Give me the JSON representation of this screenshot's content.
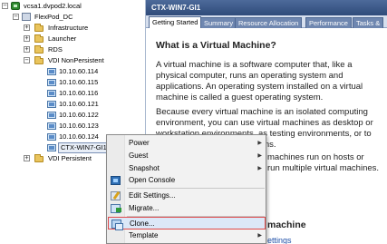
{
  "tree": {
    "root": "vcsa1.dvpod2.local",
    "datacenter": "FlexPod_DC",
    "folders": [
      "Infrastructure",
      "Launcher",
      "RDS",
      "VDI NonPersistent"
    ],
    "vms": [
      "10.10.60.114",
      "10.10.60.115",
      "10.10.60.116",
      "10.10.60.121",
      "10.10.60.122",
      "10.10.60.123",
      "10.10.60.124"
    ],
    "selected_vm": "CTX-WIN7-GI1",
    "last_folder": "VDI Persistent",
    "expand_symbol": "+",
    "collapse_symbol": "−"
  },
  "panel": {
    "title": "CTX-WIN7-GI1",
    "tabs": [
      "Getting Started",
      "Summary",
      "Resource Allocation",
      "Performance",
      "Tasks &"
    ],
    "heading": "What is a Virtual Machine?",
    "paragraph1": "A virtual machine is a software computer that, like a physical computer, runs an operating system and applications. An operating system installed on a virtual machine is called a guest operating system.",
    "paragraph2": "Because every virtual machine is an isolated computing environment, you can use virtual machines as desktop or workstation environments, as testing environments, or to consolidate server applications.",
    "paragraph3_tail": "machines run on hosts or",
    "paragraph3_tail2": "run multiple virtual machines.",
    "heading2_tail": "machine",
    "heading3_tail": "ettings"
  },
  "menu": {
    "items": [
      {
        "label": "Power",
        "submenu": true,
        "icon": "none"
      },
      {
        "label": "Guest",
        "submenu": true,
        "icon": "none"
      },
      {
        "label": "Snapshot",
        "submenu": true,
        "icon": "none"
      },
      {
        "label": "Open Console",
        "submenu": false,
        "icon": "console-icon"
      },
      {
        "label": "Edit Settings...",
        "submenu": false,
        "icon": "edit-settings-icon"
      },
      {
        "label": "Migrate...",
        "submenu": false,
        "icon": "migrate-icon"
      },
      {
        "label": "Clone...",
        "submenu": false,
        "icon": "clone-icon",
        "highlighted": true
      },
      {
        "label": "Template",
        "submenu": true,
        "icon": "none"
      }
    ],
    "submenu_arrow": "▶"
  },
  "colors": {
    "header_blue": "#3b5788",
    "tab_blue": "#6f87b0",
    "highlight_border": "#e04a4a",
    "link_blue": "#1e4fa8"
  }
}
